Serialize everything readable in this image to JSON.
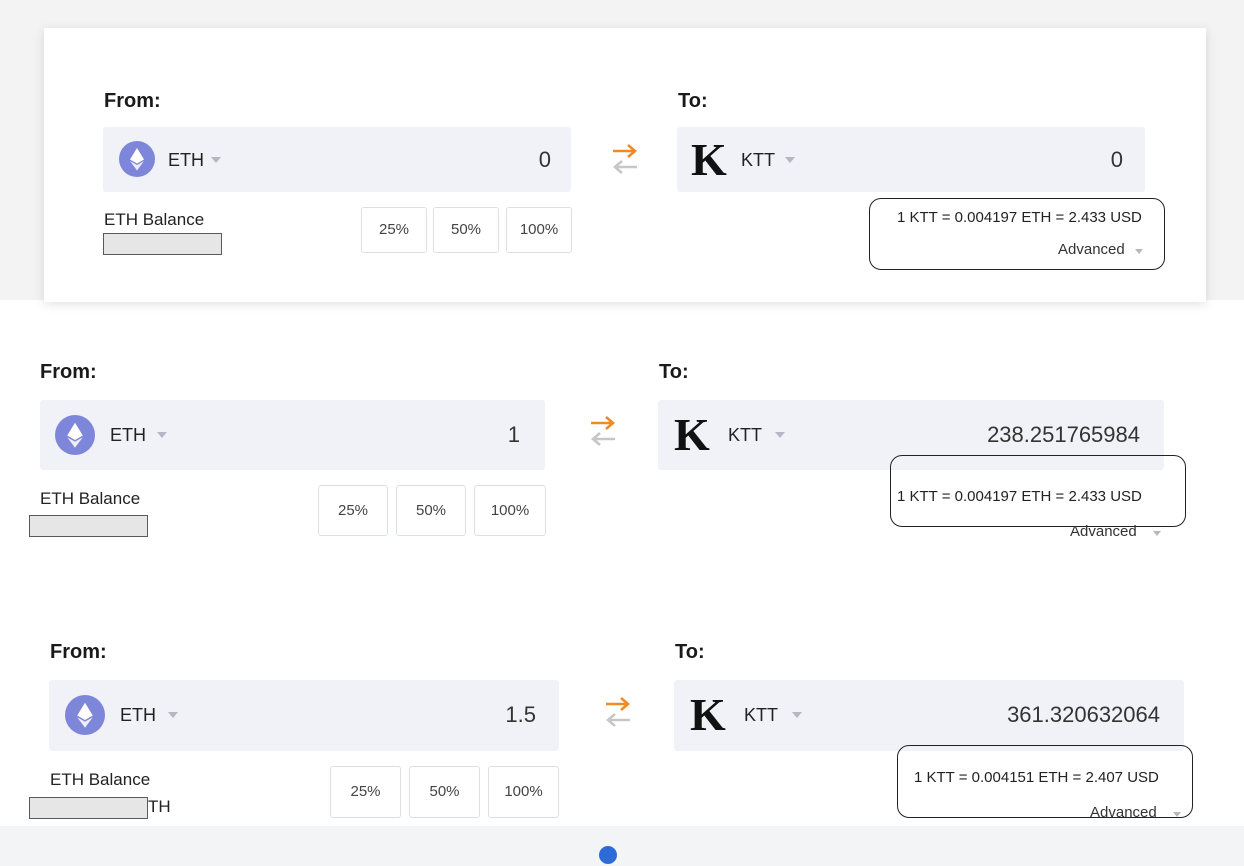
{
  "icons": {
    "from_token": "ethereum-icon",
    "to_token": "ktt-logo-k",
    "swap": "swap-arrows-icon"
  },
  "colors": {
    "accent_orange": "#f08a24",
    "eth_purple": "#7d86d8",
    "field_bg": "#f1f2f7"
  },
  "panels": [
    {
      "from_label": "From:",
      "to_label": "To:",
      "from_symbol": "ETH",
      "from_amount": "0",
      "to_logo": "K",
      "to_symbol": "KTT",
      "to_amount": "0",
      "balance_label": "ETH Balance",
      "pct": [
        "25%",
        "50%",
        "100%"
      ],
      "rate": "1 KTT = 0.004197 ETH = 2.433 USD",
      "advanced": "Advanced"
    },
    {
      "from_label": "From:",
      "to_label": "To:",
      "from_symbol": "ETH",
      "from_amount": "1",
      "to_logo": "K",
      "to_symbol": "KTT",
      "to_amount": "238.251765984",
      "balance_label": "ETH Balance",
      "pct": [
        "25%",
        "50%",
        "100%"
      ],
      "rate": "1 KTT = 0.004197 ETH = 2.433 USD",
      "advanced": "Advanced"
    },
    {
      "from_label": "From:",
      "to_label": "To:",
      "from_symbol": "ETH",
      "from_amount": "1.5",
      "to_logo": "K",
      "to_symbol": "KTT",
      "to_amount": "361.320632064",
      "balance_label": "ETH Balance",
      "balance_fragment": "TH",
      "pct": [
        "25%",
        "50%",
        "100%"
      ],
      "rate": "1 KTT = 0.004151 ETH = 2.407 USD",
      "advanced": "Advanced"
    }
  ]
}
